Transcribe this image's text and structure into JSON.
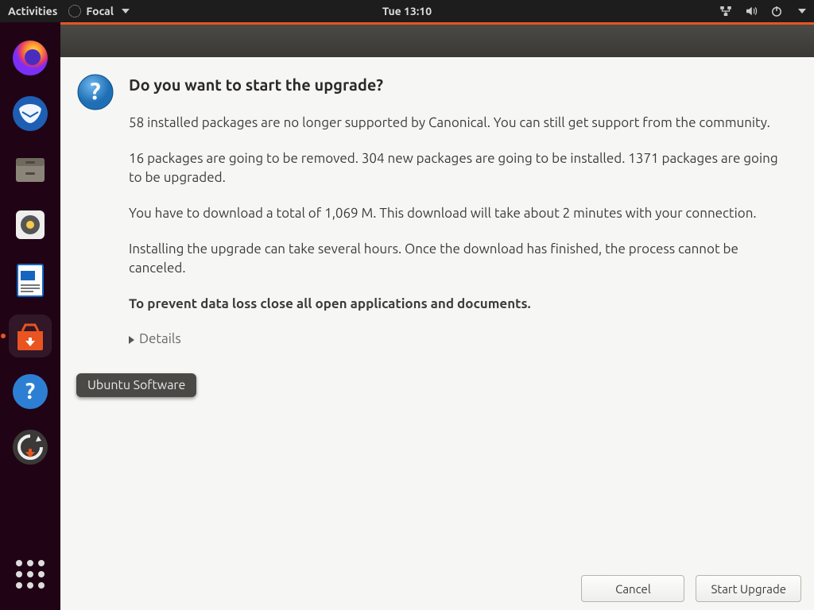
{
  "topbar": {
    "activities": "Activities",
    "app_name": "Focal",
    "clock": "Tue 13:10"
  },
  "dock": {
    "items": [
      {
        "name": "firefox",
        "label": "Firefox"
      },
      {
        "name": "thunderbird",
        "label": "Thunderbird"
      },
      {
        "name": "files",
        "label": "Files"
      },
      {
        "name": "rhythmbox",
        "label": "Rhythmbox"
      },
      {
        "name": "libreoffice-writer",
        "label": "LibreOffice Writer"
      },
      {
        "name": "ubuntu-software",
        "label": "Ubuntu Software"
      },
      {
        "name": "help",
        "label": "Help"
      },
      {
        "name": "software-updater",
        "label": "Software Updater"
      }
    ],
    "tooltip": "Ubuntu Software"
  },
  "dialog": {
    "heading": "Do you want to start the upgrade?",
    "paragraphs": [
      "58 installed packages are no longer supported by Canonical. You can still get support from the community.",
      "16 packages are going to be removed. 304 new packages are going to be installed. 1371 packages are going to be upgraded.",
      "You have to download a total of 1,069 M. This download will take about 2 minutes with your connection.",
      "Installing the upgrade can take several hours. Once the download has finished, the process cannot be canceled."
    ],
    "warning": "To prevent data loss close all open applications and documents.",
    "details_label": "Details",
    "buttons": {
      "cancel": "Cancel",
      "start": "Start Upgrade"
    }
  }
}
